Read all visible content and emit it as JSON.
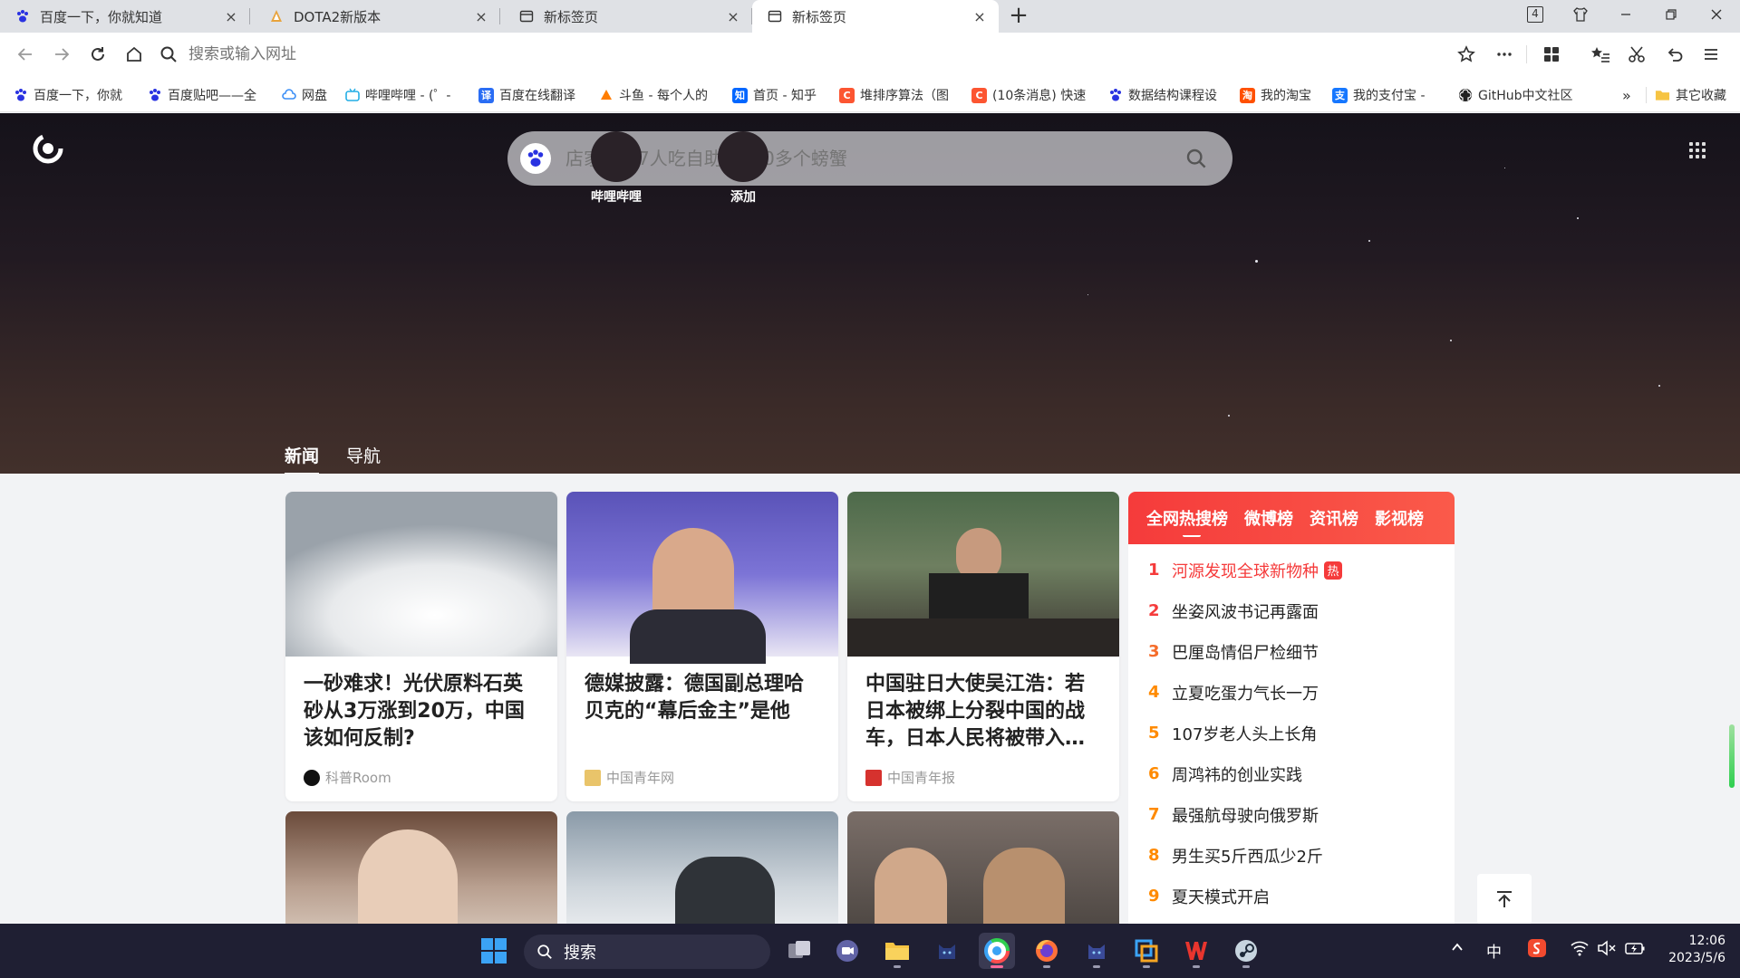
{
  "tabs": [
    {
      "title": "百度一下，你就知道",
      "close": "×"
    },
    {
      "title": "DOTA2新版本",
      "close": "×"
    },
    {
      "title": "新标签页",
      "close": "×"
    },
    {
      "title": "新标签页",
      "close": "×"
    }
  ],
  "window_badge": "4",
  "address": {
    "placeholder": "搜索或输入网址"
  },
  "bookmarks": [
    {
      "label": "百度一下，你就",
      "icon": "baidu-paw",
      "color": "#2932e1"
    },
    {
      "label": "百度贴吧——全",
      "icon": "baidu-paw",
      "color": "#2932e1"
    },
    {
      "label": "网盘",
      "icon": "cloud",
      "color": "#3a8ef6"
    },
    {
      "label": "哔哩哔哩 - (゜-",
      "icon": "bilibili",
      "color": "#23ade5"
    },
    {
      "label": "百度在线翻译",
      "icon": "translate",
      "color": "#2a6df4"
    },
    {
      "label": "斗鱼 - 每个人的",
      "icon": "douyu",
      "color": "#ff7d00"
    },
    {
      "label": "首页 - 知乎",
      "icon": "zhihu",
      "color": "#0066ff"
    },
    {
      "label": "堆排序算法（图",
      "icon": "csdn",
      "color": "#fc5531"
    },
    {
      "label": "(10条消息) 快速",
      "icon": "csdn",
      "color": "#fc5531"
    },
    {
      "label": "数据结构课程设",
      "icon": "baidu-paw",
      "color": "#2932e1"
    },
    {
      "label": "我的淘宝",
      "icon": "taobao",
      "color": "#ff5000"
    },
    {
      "label": "我的支付宝 -",
      "icon": "alipay",
      "color": "#1677ff"
    },
    {
      "label": "GitHub中文社区",
      "icon": "github",
      "color": "#222222"
    }
  ],
  "bookmarks_more": "»",
  "other_bookmarks": "其它收藏",
  "search": {
    "placeholder": "店家回应7人吃自助炫300多个螃蟹"
  },
  "shortcuts": [
    {
      "label": "哔哩哔哩"
    },
    {
      "label": "添加"
    }
  ],
  "feed_tabs": [
    {
      "label": "新闻",
      "active": true
    },
    {
      "label": "导航",
      "active": false
    }
  ],
  "news_cards": [
    {
      "title": "一砂难求！光伏原料石英砂从3万涨到20万，中国该如何反制?",
      "source": "科普Room"
    },
    {
      "title": "德媒披露：德国副总理哈贝克的“幕后金主”是他",
      "source": "中国青年网"
    },
    {
      "title": "中国驻日大使吴江浩：若日本被绑上分裂中国的战车，日本人民将被带入…",
      "source": "中国青年报"
    }
  ],
  "hot": {
    "tabs": [
      "全网热搜榜",
      "微博榜",
      "资讯榜",
      "影视榜"
    ],
    "items": [
      {
        "rank": "1",
        "text": "河源发现全球新物种",
        "badge": "热"
      },
      {
        "rank": "2",
        "text": "坐姿风波书记再露面"
      },
      {
        "rank": "3",
        "text": "巴厘岛情侣尸检细节"
      },
      {
        "rank": "4",
        "text": "立夏吃蛋力气长一万"
      },
      {
        "rank": "5",
        "text": "107岁老人头上长角"
      },
      {
        "rank": "6",
        "text": "周鸿祎的创业实践"
      },
      {
        "rank": "7",
        "text": "最强航母驶向俄罗斯"
      },
      {
        "rank": "8",
        "text": "男生买5斤西瓜少2斤"
      },
      {
        "rank": "9",
        "text": "夏天模式开启"
      }
    ]
  },
  "taskbar": {
    "search_label": "搜索",
    "ime": "中",
    "time": "12:06",
    "date": "2023/5/6"
  },
  "colors": {
    "accent_red": "#f53b3b",
    "rank_orange": "#ff8a00"
  }
}
